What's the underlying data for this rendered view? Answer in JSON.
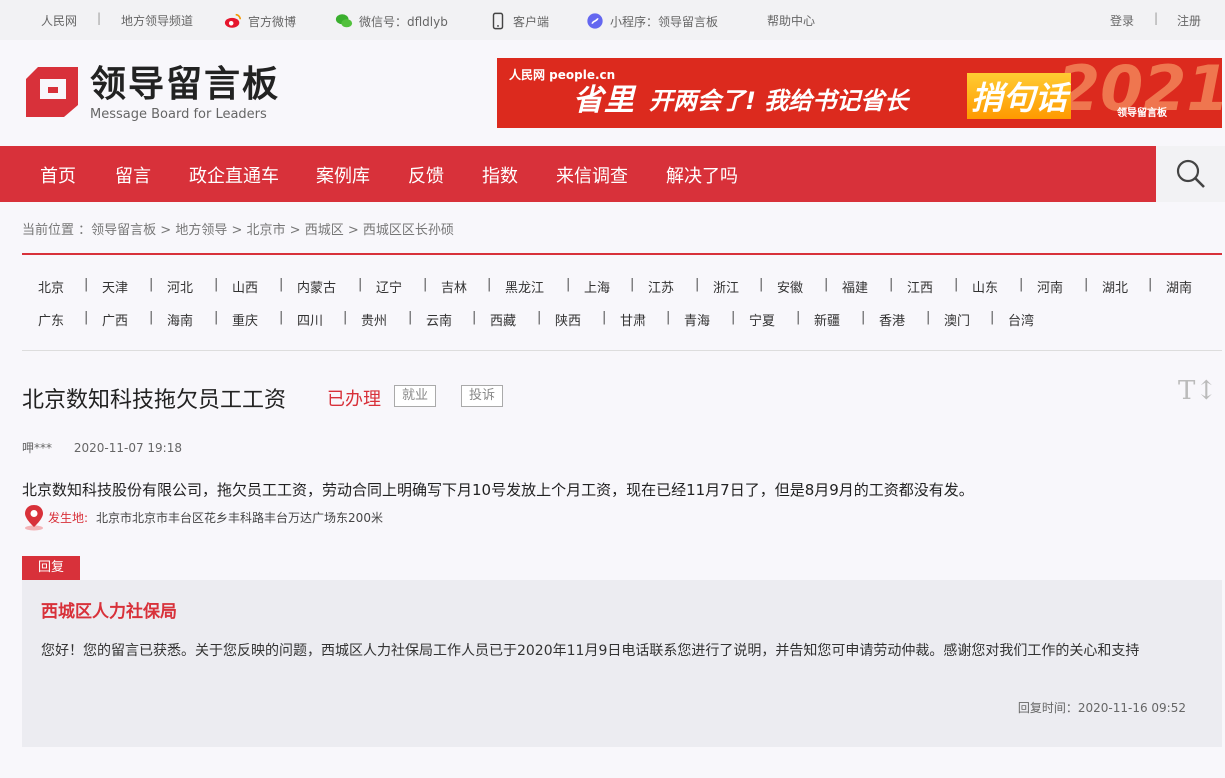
{
  "topbar": {
    "people": "人民网",
    "channel": "地方领导频道",
    "weibo": "官方微博",
    "wechat": "微信号：dfldlyb",
    "app": "客户端",
    "mini": "小程序：领导留言板",
    "help": "帮助中心",
    "login": "登录",
    "register": "注册",
    "sep": "|"
  },
  "logo": {
    "cn": "领导留言板",
    "en": "Message Board for Leaders"
  },
  "banner": {
    "source": "人民网 people.cn",
    "text_a": "省里",
    "text_b": "开两会了! 我给书记省长",
    "text_c": "捎句话",
    "year": "2021",
    "brand": "领导留言板"
  },
  "nav": [
    "首页",
    "留言",
    "政企直通车",
    "案例库",
    "反馈",
    "指数",
    "来信调查",
    "解决了吗"
  ],
  "breadcrumb": {
    "prefix": "当前位置 ：",
    "items": [
      "领导留言板",
      "地方领导",
      "北京市",
      "西城区",
      "西城区区长孙硕"
    ],
    "sep": " > "
  },
  "regions": {
    "row1": [
      "北京",
      "天津",
      "河北",
      "山西",
      "内蒙古",
      "辽宁",
      "吉林",
      "黑龙江",
      "上海",
      "江苏",
      "浙江",
      "安徽",
      "福建",
      "江西",
      "山东",
      "河南",
      "湖北",
      "湖南"
    ],
    "row2": [
      "广东",
      "广西",
      "海南",
      "重庆",
      "四川",
      "贵州",
      "云南",
      "西藏",
      "陕西",
      "甘肃",
      "青海",
      "宁夏",
      "新疆",
      "香港",
      "澳门",
      "台湾"
    ]
  },
  "message": {
    "title": "北京数知科技拖欠员工工资",
    "status": "已办理",
    "tags": [
      "就业",
      "投诉"
    ],
    "author": "呷***",
    "date": "2020-11-07 19:18",
    "body": "北京数知科技股份有限公司，拖欠员工工资，劳动合同上明确写下月10号发放上个月工资，现在已经11月7日了，但是8月9月的工资都没有发。",
    "location_label": "发生地:",
    "location": "北京市北京市丰台区花乡丰科路丰台万达广场东200米"
  },
  "reply": {
    "tab": "回复",
    "org": "西城区人力社保局",
    "body": "您好！您的留言已获悉。关于您反映的问题，西城区人力社保局工作人员已于2020年11月9日电话联系您进行了说明，并告知您可申请劳动仲裁。感谢您对我们工作的关心和支持",
    "time_label": "回复时间：",
    "time": "2020-11-16 09:52"
  },
  "colors": {
    "brand_red": "#d8313a",
    "banner_red": "#dc2a1e"
  },
  "icons": [
    "weibo-icon",
    "wechat-icon",
    "phone-icon",
    "miniprogram-icon",
    "search-icon",
    "font-size-icon",
    "location-pin-icon",
    "logo-mark-icon"
  ]
}
